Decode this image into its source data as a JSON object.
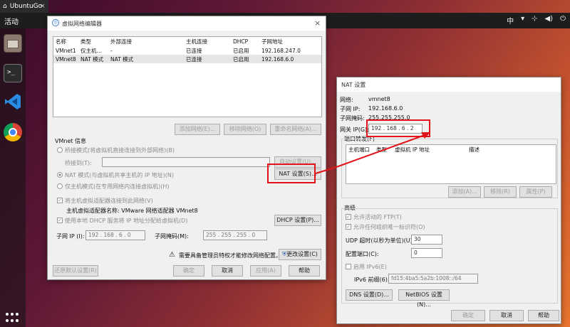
{
  "vm_tab": {
    "title": "UbuntuGo"
  },
  "topbar": {
    "activities": "活动",
    "input_method": "中",
    "tray_arrow": "▾"
  },
  "vnet": {
    "title": "虚拟网络编辑器",
    "columns": [
      "名称",
      "类型",
      "外部连接",
      "主机连接",
      "DHCP",
      "子网地址"
    ],
    "rows": [
      [
        "VMnet1",
        "仅主机…",
        "-",
        "已连接",
        "已启用",
        "192.168.247.0"
      ],
      [
        "VMnet8",
        "NAT 模式",
        "NAT 模式",
        "已连接",
        "已启用",
        "192.168.6.0"
      ]
    ],
    "add_network": "添加网络(E)...",
    "remove_network": "移除网络(O)",
    "rename_network": "重命名网络(A)...",
    "info_title": "VMnet 信息",
    "bridge_mode": "桥接模式(将虚拟机直接连接到外部网络)(B)",
    "bridge_to": "桥接到(T):",
    "auto_settings": "自动设置(U)...",
    "nat_mode": "NAT 模式(与虚拟机共享主机的 IP 地址)(N)",
    "nat_settings": "NAT 设置(S)...",
    "host_only": "仅主机模式(在专用网络内连接虚拟机)(H)",
    "connect_adapter": "将主机虚拟适配器连接到此网络(V)",
    "adapter_name": "主机虚拟适配器名称: VMware 网络适配器 VMnet8",
    "use_dhcp": "使用本地 DHCP 服务将 IP 地址分配给虚拟机(D)",
    "dhcp_settings": "DHCP 设置(P)...",
    "subnet_ip_label": "子网 IP (I):",
    "subnet_ip": "192 . 168 . 6 . 0",
    "subnet_mask_label": "子网掩码(M):",
    "subnet_mask": "255 . 255 . 255 . 0",
    "admin_notice": "需要具备管理员特权才能修改网络配置。",
    "change_settings": "更改设置(C)",
    "restore_defaults": "还原默认设置(R)",
    "ok": "确定",
    "cancel": "取消",
    "apply": "应用(A)",
    "help": "帮助"
  },
  "nat": {
    "title": "NAT 设置",
    "network_label": "网络:",
    "network": "vmnet8",
    "subnet_ip_label": "子网 IP:",
    "subnet_ip": "192.168.6.0",
    "subnet_mask_label": "子网掩码:",
    "subnet_mask": "255.255.255.0",
    "gateway_label": "网关 IP(G):",
    "gateway": "192 . 168 . 6 . 2",
    "port_forward_title": "端口转发(F)",
    "pf_columns": [
      "主机端口",
      "类型",
      "虚拟机 IP 地址",
      "描述"
    ],
    "add": "添加(A)...",
    "remove": "移除(R)",
    "properties": "属性(P)",
    "advanced_title": "高级",
    "allow_ftp": "允许活动的 FTP(T)",
    "allow_org_id": "允许任何组织唯一标识符(O)",
    "udp_timeout_label": "UDP 超时(以秒为单位)(U):",
    "udp_timeout": "30",
    "config_port_label": "配置端口(C):",
    "config_port": "0",
    "enable_ipv6": "启用 IPv6(E)",
    "ipv6_prefix_label": "IPv6 前缀(6):",
    "ipv6_prefix": "fd15:4ba5:5a2b:1008::/64",
    "dns_settings": "DNS 设置(D)...",
    "netbios_settings": "NetBIOS 设置(N)...",
    "ok": "确定",
    "cancel": "取消",
    "help": "帮助"
  },
  "colors": {
    "accent": "#e0141a",
    "dock": "#2b2b2b",
    "dialog": "#f0f0f0"
  },
  "icons": [
    "network-icon",
    "close-icon",
    "shield-icon",
    "warning-icon",
    "files-icon",
    "terminal-icon",
    "vscode-icon",
    "chrome-icon",
    "network-tray-icon",
    "volume-icon",
    "power-icon",
    "apps-grid-icon"
  ]
}
